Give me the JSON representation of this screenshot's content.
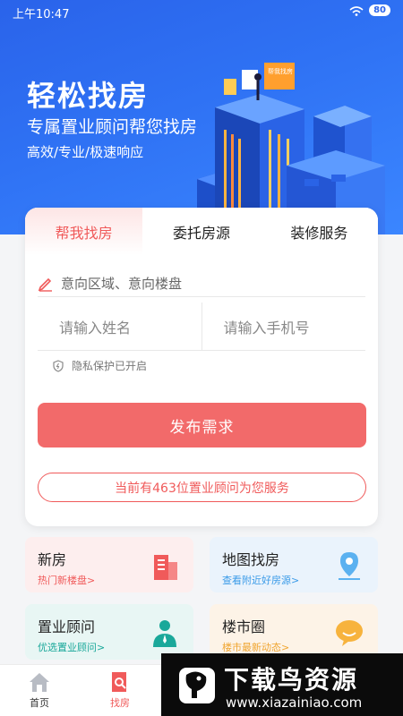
{
  "status": {
    "time": "上午10:47",
    "battery": "80"
  },
  "hero": {
    "title": "轻松找房",
    "subtitle": "专属置业顾问帮您找房",
    "tagline": "高效/专业/极速响应",
    "sign_text": "帮我找房"
  },
  "tabs": [
    {
      "label": "帮我找房",
      "active": true
    },
    {
      "label": "委托房源",
      "active": false
    },
    {
      "label": "装修服务",
      "active": false
    }
  ],
  "form": {
    "area_placeholder": "意向区域、意向楼盘",
    "name_placeholder": "请输入姓名",
    "phone_placeholder": "请输入手机号",
    "privacy": "隐私保护已开启",
    "submit_label": "发布需求",
    "advisor_text": "当前有463位置业顾问为您服务"
  },
  "tiles": [
    {
      "title": "新房",
      "subtitle": "热门新楼盘>",
      "accent": "#f05a5a",
      "icon": "building-icon"
    },
    {
      "title": "地图找房",
      "subtitle": "查看附近好房源>",
      "accent": "#3a9be8",
      "icon": "map-pin-icon"
    },
    {
      "title": "置业顾问",
      "subtitle": "优选置业顾问>",
      "accent": "#1aa89a",
      "icon": "advisor-icon"
    },
    {
      "title": "楼市圈",
      "subtitle": "楼市最新动态>",
      "accent": "#f0a530",
      "icon": "chat-bubble-icon"
    }
  ],
  "nav": [
    {
      "label": "首页",
      "icon": "home-icon"
    },
    {
      "label": "找房",
      "icon": "find-house-icon",
      "active": true
    }
  ],
  "watermark": {
    "title": "下载鸟资源",
    "url": "www.xiazainiao.com"
  },
  "colors": {
    "primary": "#2f72f4",
    "accent": "#f26a6a"
  }
}
